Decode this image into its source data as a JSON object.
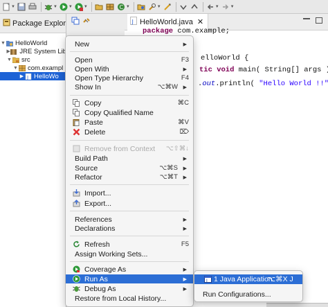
{
  "toolbar": {
    "icons": [
      "new-file",
      "save",
      "print",
      "debug",
      "run",
      "external-tools",
      "new-java-project",
      "new-package",
      "new-class",
      "open-type",
      "search",
      "next-annotation",
      "prev-annotation",
      "back",
      "forward"
    ]
  },
  "package_explorer": {
    "title": "Package Explorer",
    "close": "✕",
    "tree": [
      {
        "label": "HelloWorld",
        "icon": "project"
      },
      {
        "label": "JRE System Lib",
        "icon": "library"
      },
      {
        "label": "src",
        "icon": "source-folder"
      },
      {
        "label": "com.exampl",
        "icon": "package"
      },
      {
        "label": "HelloWo",
        "icon": "java-file"
      }
    ]
  },
  "editor": {
    "tab_label": "HelloWorld.java",
    "tab_close": "✕",
    "code": [
      {
        "kw": "package",
        "text": " com.example;"
      },
      {
        "text": "elloWorld {"
      },
      {
        "kw": "tic void",
        "text": " main( String[] args ) {"
      },
      {
        "prefix": ".",
        "fld": "out",
        "mid": ".println( ",
        "str": "\"Hello World !!\"",
        "tail": " );"
      }
    ]
  },
  "context_menu": {
    "items": [
      {
        "label": "New",
        "arrow": "▶"
      },
      {
        "label": "Open",
        "shortcut": "F3"
      },
      {
        "label": "Open With",
        "arrow": "▶"
      },
      {
        "label": "Open Type Hierarchy",
        "shortcut": "F4"
      },
      {
        "label": "Show In",
        "shortcut": "⌥⌘W",
        "arrow": "▶"
      },
      {
        "label": "Copy",
        "shortcut": "⌘C",
        "icon": "copy"
      },
      {
        "label": "Copy Qualified Name",
        "icon": "copy"
      },
      {
        "label": "Paste",
        "shortcut": "⌘V",
        "icon": "paste"
      },
      {
        "label": "Delete",
        "shortcut": "⌦",
        "icon": "delete"
      },
      {
        "label": "Remove from Context",
        "shortcut": "⌥⇧⌘↓",
        "icon": "remove-context",
        "disabled": true
      },
      {
        "label": "Build Path",
        "arrow": "▶"
      },
      {
        "label": "Source",
        "shortcut": "⌥⌘S",
        "arrow": "▶"
      },
      {
        "label": "Refactor",
        "shortcut": "⌥⌘T",
        "arrow": "▶"
      },
      {
        "label": "Import...",
        "icon": "import"
      },
      {
        "label": "Export...",
        "icon": "export"
      },
      {
        "label": "References",
        "arrow": "▶"
      },
      {
        "label": "Declarations",
        "arrow": "▶"
      },
      {
        "label": "Refresh",
        "shortcut": "F5",
        "icon": "refresh"
      },
      {
        "label": "Assign Working Sets..."
      },
      {
        "label": "Coverage As",
        "icon": "coverage",
        "arrow": "▶"
      },
      {
        "label": "Run As",
        "icon": "run",
        "arrow": "▶",
        "highlighted": true
      },
      {
        "label": "Debug As",
        "icon": "debug",
        "arrow": "▶"
      },
      {
        "label": "Restore from Local History..."
      }
    ]
  },
  "run_as_submenu": {
    "items": [
      {
        "label": "1 Java Application",
        "shortcut": "⌥⌘X J",
        "icon": "java-app",
        "highlighted": true
      },
      {
        "label": "Run Configurations..."
      }
    ]
  },
  "colors": {
    "selection": "#1e63d6",
    "menu_highlight": "#2c6ed5",
    "keyword": "#7f0055",
    "string": "#2a00ff",
    "field": "#0000c0"
  }
}
